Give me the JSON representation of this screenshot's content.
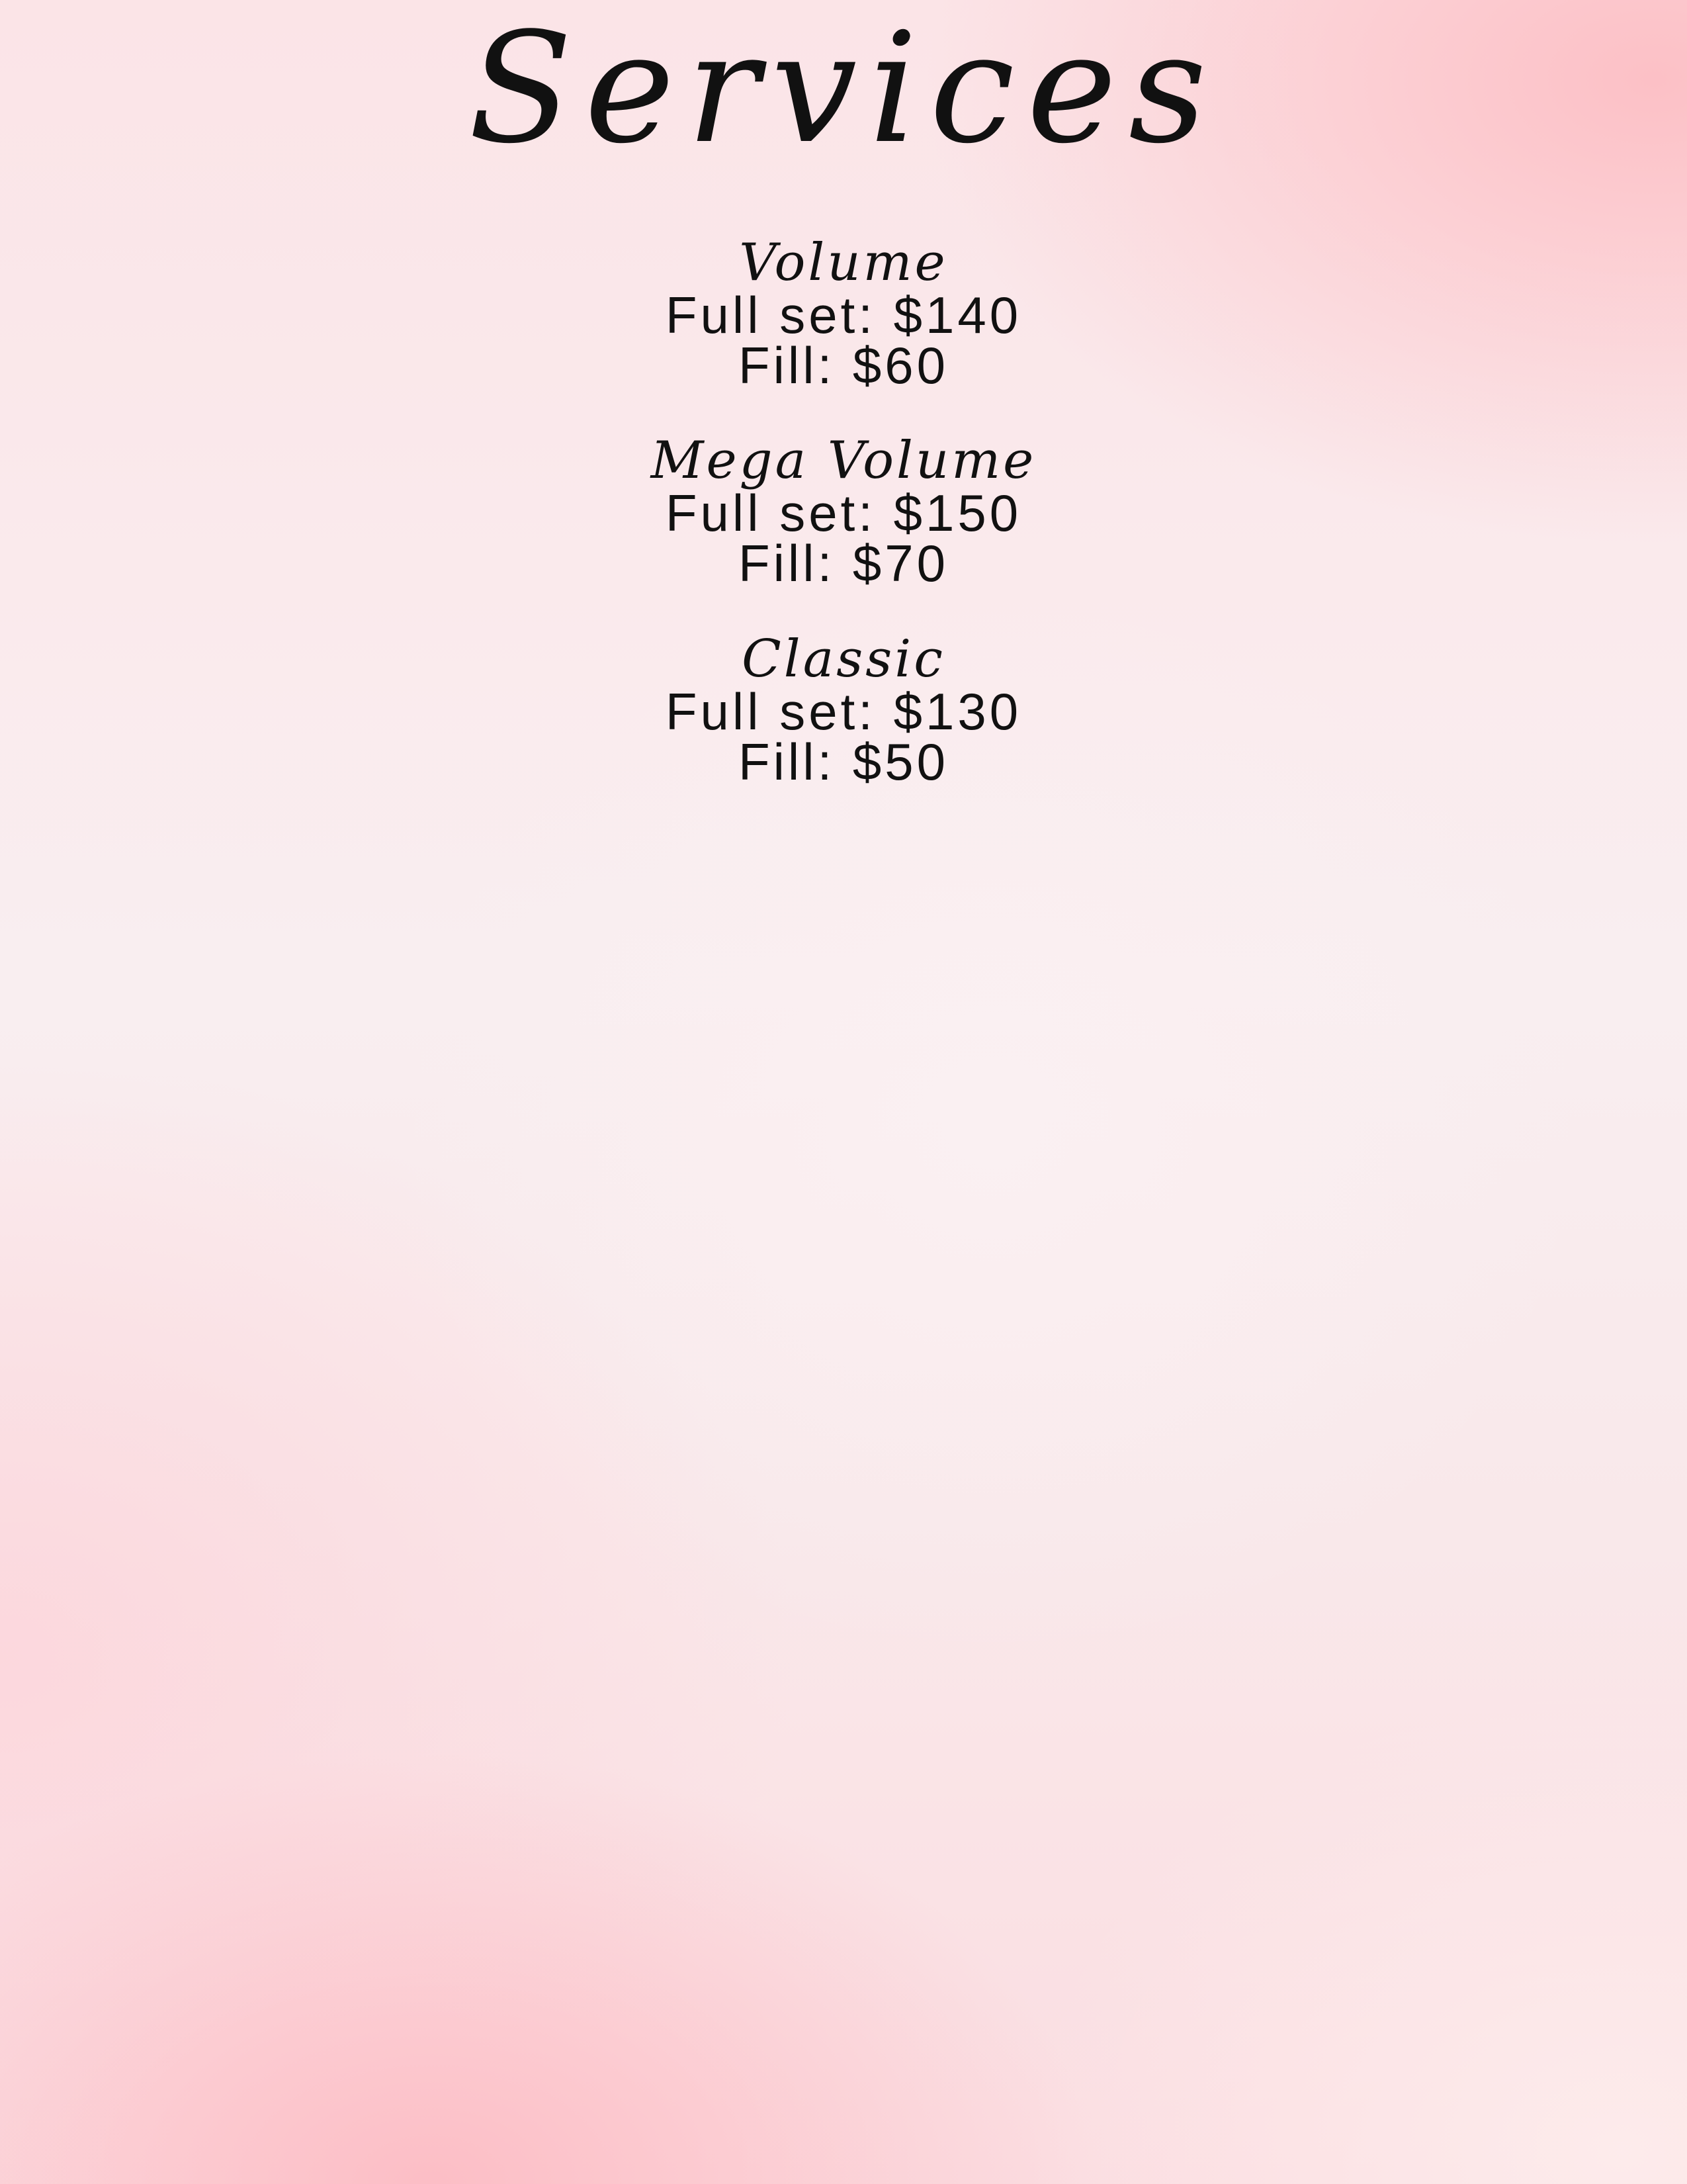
{
  "title": "Services",
  "services": [
    {
      "name": "Volume",
      "full_set": "Full set: $140",
      "fill": "Fill: $60"
    },
    {
      "name": "Mega Volume",
      "full_set": "Full set: $150",
      "fill": "Fill: $70"
    },
    {
      "name": "Classic",
      "full_set": "Full set: $130",
      "fill": "Fill: $50"
    }
  ]
}
